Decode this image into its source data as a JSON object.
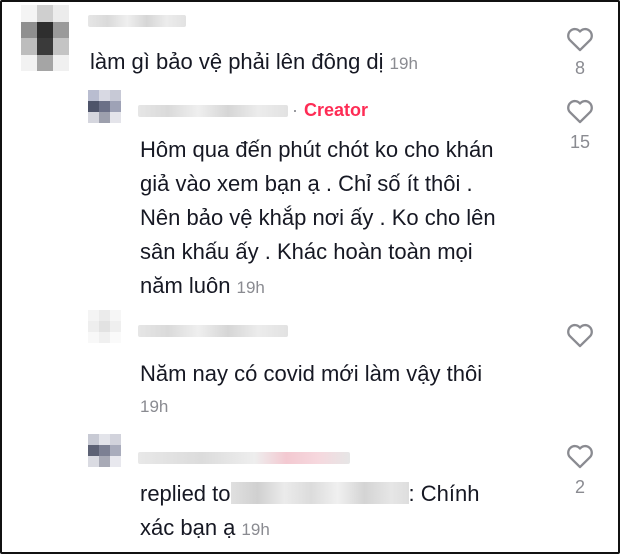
{
  "comments": [
    {
      "text": "làm gì bảo vệ phải lên đông dị",
      "time": "19h",
      "likes": "8"
    },
    {
      "badge": "Creator",
      "separator": "·",
      "lines": [
        "Hôm qua đến phút chót ko cho khán",
        "giả vào xem bạn ạ . Chỉ số ít thôi .",
        "Nên bảo vệ khắp nơi ấy . Ko cho lên",
        "sân khấu ấy . Khác hoàn toàn mọi",
        "năm luôn"
      ],
      "time": "19h",
      "likes": "15"
    },
    {
      "text": "Năm nay có covid mới làm vậy thôi",
      "time": "19h",
      "likes": ""
    },
    {
      "replied_prefix": "replied to",
      "replied_suffix": ": Chính",
      "line2": "xác bạn ạ",
      "time": "19h",
      "likes": "2"
    }
  ],
  "icons": {
    "like": "heart-outline-icon"
  },
  "colors": {
    "creator": "#fe2c55",
    "muted": "#8a8b91",
    "text": "#161823"
  }
}
